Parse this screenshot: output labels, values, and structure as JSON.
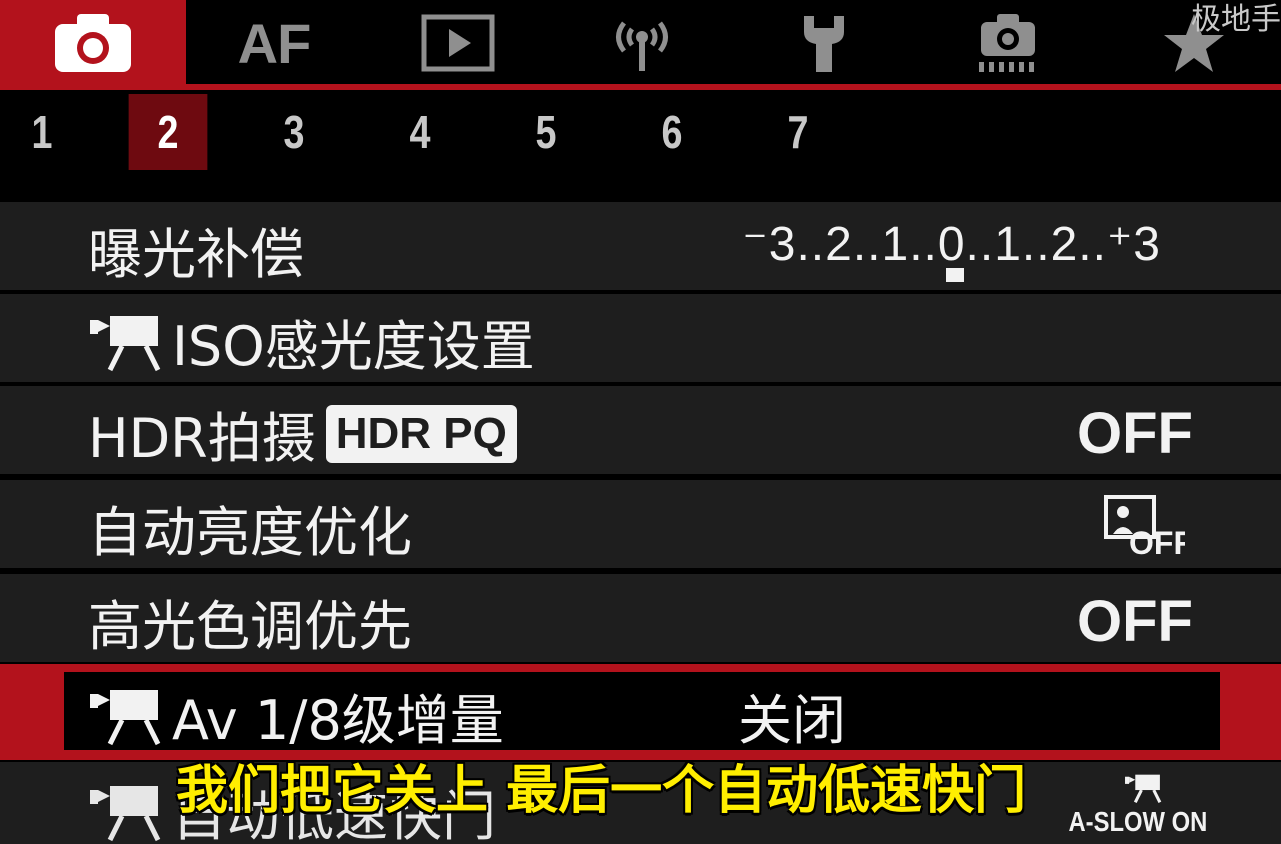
{
  "watermark": "极地手",
  "category_tabs": [
    {
      "icon": "camera-icon",
      "active": true
    },
    {
      "label": "AF"
    },
    {
      "icon": "playback-icon"
    },
    {
      "icon": "wireless-icon"
    },
    {
      "icon": "wrench-icon"
    },
    {
      "icon": "custom-function-icon"
    },
    {
      "icon": "star-icon"
    }
  ],
  "accent_color": "#b3121c",
  "number_tabs": [
    "1",
    "2",
    "3",
    "4",
    "5",
    "6",
    "7"
  ],
  "active_number_tab": "2",
  "menu_items": [
    {
      "label": "曝光补偿",
      "value": "⁻3..2..1..0..1..2..⁺3"
    },
    {
      "label": "ISO感光度设置",
      "icon": "movie-icon"
    },
    {
      "label": "HDR拍摄",
      "badge": "HDR PQ",
      "value": "OFF"
    },
    {
      "label": "自动亮度优化",
      "value_icon": "auto-lighting-optimizer-off-icon",
      "value_icon_text": "OFF"
    },
    {
      "label": "高光色调优先",
      "value": "OFF"
    },
    {
      "label": "Av 1/8级增量",
      "icon": "movie-icon",
      "value": "关闭",
      "selected": true
    },
    {
      "label": "自动低速快门",
      "icon": "movie-icon",
      "value": "A-SLOW ON"
    }
  ],
  "subtitle": "我们把它关上 最后一个自动低速快门"
}
